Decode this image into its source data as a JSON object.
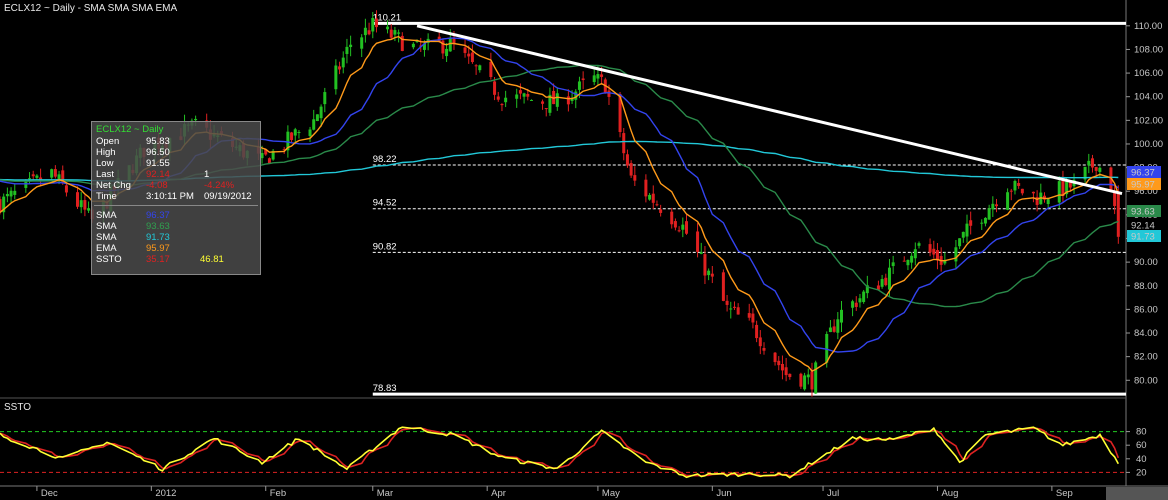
{
  "chart_title": "ECLX12 ~ Daily  -  SMA SMA SMA EMA",
  "lower_panel_title": "SSTO",
  "info_box": {
    "header": "ECLX12 ~ Daily",
    "open_label": "Open",
    "open": "95.83",
    "high_label": "High",
    "high": "96.50",
    "low_label": "Low",
    "low": "91.55",
    "last_label": "Last",
    "last": "92.14",
    "last_vol": "1",
    "netchg_label": "Net Chg",
    "netchg": "-4.08",
    "netchg_pct": "-4.24%",
    "time_label": "Time",
    "time": "3:10:11 PM",
    "date": "09/19/2012",
    "sma1_label": "SMA",
    "sma1": "96.37",
    "sma2_label": "SMA",
    "sma2": "93.63",
    "sma3_label": "SMA",
    "sma3": "91.73",
    "ema_label": "EMA",
    "ema": "95.97",
    "ssto_label": "SSTO",
    "ssto_k": "35.17",
    "ssto_d": "46.81"
  },
  "colors": {
    "up": "#22c022",
    "down": "#e02020",
    "sma_fast": "#3344ee",
    "sma_mid": "#2a8a4a",
    "sma_slow": "#22c8d8",
    "ema": "#ff9a1a",
    "ssto_k": "#ffff33",
    "ssto_d": "#dd2222",
    "upper_band": "#22cc22",
    "lower_band": "#dd2222"
  },
  "chart_data": [
    {
      "type": "candlestick",
      "title": "ECLX12 ~ Daily  -  SMA SMA SMA EMA",
      "ylim": [
        78.5,
        111
      ],
      "y_ticks": [
        "110.00",
        "108.00",
        "106.00",
        "104.00",
        "102.00",
        "100.00",
        "98.00",
        "96.00",
        "94.00",
        "92.00",
        "90.00",
        "88.00",
        "86.00",
        "84.00",
        "82.00",
        "80.00"
      ],
      "x_labels": [
        "Dec",
        "2012",
        "Feb",
        "Mar",
        "Apr",
        "May",
        "Jun",
        "Jul",
        "Aug",
        "Sep"
      ],
      "annotated_levels": [
        {
          "label": "110.21",
          "value": 110.21,
          "style": "solid"
        },
        {
          "label": "98.22",
          "value": 98.22,
          "style": "dashed"
        },
        {
          "label": "94.52",
          "value": 94.52,
          "style": "dashed"
        },
        {
          "label": "90.82",
          "value": 90.82,
          "style": "dashed"
        },
        {
          "label": "78.83",
          "value": 78.83,
          "style": "solid"
        }
      ],
      "trendline": [
        {
          "date": "2012-03-13",
          "value": 110.0
        },
        {
          "date": "2012-09-20",
          "value": 95.8
        }
      ],
      "last_value_badges": [
        {
          "label": "96.37",
          "series": "sma_fast"
        },
        {
          "label": "95.97",
          "series": "ema"
        },
        {
          "label": "93.63",
          "series": "sma_mid"
        },
        {
          "label": "92.14",
          "series": "last"
        },
        {
          "label": "91.73",
          "series": "sma_slow"
        }
      ],
      "price_anchors": [
        {
          "date": "2011-11-21",
          "close": 95.0
        },
        {
          "date": "2011-12-05",
          "close": 97.5
        },
        {
          "date": "2011-12-16",
          "close": 93.5
        },
        {
          "date": "2011-12-30",
          "close": 99.5
        },
        {
          "date": "2012-01-13",
          "close": 101.5
        },
        {
          "date": "2012-01-31",
          "close": 98.5
        },
        {
          "date": "2012-02-14",
          "close": 102.0
        },
        {
          "date": "2012-02-24",
          "close": 108.5
        },
        {
          "date": "2012-03-01",
          "close": 110.0
        },
        {
          "date": "2012-03-13",
          "close": 108.0
        },
        {
          "date": "2012-03-22",
          "close": 108.5
        },
        {
          "date": "2012-04-05",
          "close": 104.0
        },
        {
          "date": "2012-04-20",
          "close": 103.5
        },
        {
          "date": "2012-04-30",
          "close": 105.5
        },
        {
          "date": "2012-05-03",
          "close": 105.0
        },
        {
          "date": "2012-05-10",
          "close": 97.0
        },
        {
          "date": "2012-05-24",
          "close": 93.0
        },
        {
          "date": "2012-06-05",
          "close": 86.0
        },
        {
          "date": "2012-06-12",
          "close": 84.5
        },
        {
          "date": "2012-06-21",
          "close": 80.5
        },
        {
          "date": "2012-06-28",
          "close": 80.0
        },
        {
          "date": "2012-07-05",
          "close": 85.5
        },
        {
          "date": "2012-07-19",
          "close": 89.0
        },
        {
          "date": "2012-07-26",
          "close": 91.5
        },
        {
          "date": "2012-08-03",
          "close": 90.0
        },
        {
          "date": "2012-08-10",
          "close": 93.0
        },
        {
          "date": "2012-08-20",
          "close": 96.5
        },
        {
          "date": "2012-08-28",
          "close": 95.5
        },
        {
          "date": "2012-09-07",
          "close": 96.5
        },
        {
          "date": "2012-09-13",
          "close": 98.5
        },
        {
          "date": "2012-09-17",
          "close": 96.5
        },
        {
          "date": "2012-09-19",
          "close": 92.14
        }
      ]
    },
    {
      "type": "line",
      "title": "SSTO",
      "ylim": [
        0,
        100
      ],
      "y_ticks": [
        "80",
        "60",
        "40",
        "20"
      ],
      "bands": [
        80,
        20
      ],
      "ssto_anchors": [
        {
          "date": "2011-11-21",
          "k": 75
        },
        {
          "date": "2011-12-08",
          "k": 40
        },
        {
          "date": "2011-12-20",
          "k": 65
        },
        {
          "date": "2012-01-04",
          "k": 25
        },
        {
          "date": "2012-01-18",
          "k": 70
        },
        {
          "date": "2012-01-31",
          "k": 35
        },
        {
          "date": "2012-02-10",
          "k": 70
        },
        {
          "date": "2012-02-23",
          "k": 25
        },
        {
          "date": "2012-03-09",
          "k": 88
        },
        {
          "date": "2012-03-23",
          "k": 75
        },
        {
          "date": "2012-04-05",
          "k": 42
        },
        {
          "date": "2012-04-20",
          "k": 25
        },
        {
          "date": "2012-05-02",
          "k": 80
        },
        {
          "date": "2012-05-14",
          "k": 35
        },
        {
          "date": "2012-05-25",
          "k": 15
        },
        {
          "date": "2012-06-11",
          "k": 18
        },
        {
          "date": "2012-06-22",
          "k": 15
        },
        {
          "date": "2012-07-09",
          "k": 70
        },
        {
          "date": "2012-07-20",
          "k": 68
        },
        {
          "date": "2012-07-31",
          "k": 85
        },
        {
          "date": "2012-08-07",
          "k": 35
        },
        {
          "date": "2012-08-14",
          "k": 75
        },
        {
          "date": "2012-08-27",
          "k": 85
        },
        {
          "date": "2012-09-04",
          "k": 60
        },
        {
          "date": "2012-09-14",
          "k": 75
        },
        {
          "date": "2012-09-19",
          "k": 35
        }
      ]
    }
  ]
}
